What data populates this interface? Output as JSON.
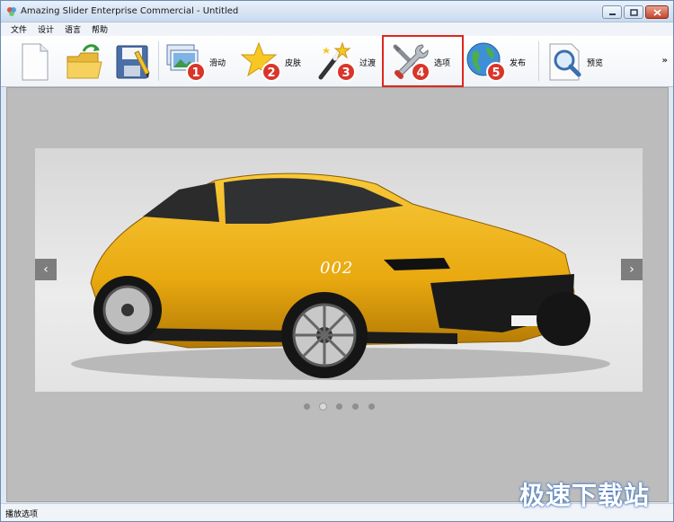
{
  "window": {
    "title": "Amazing Slider Enterprise Commercial - Untitled"
  },
  "menu": {
    "items": [
      "文件",
      "设计",
      "语言",
      "帮助"
    ]
  },
  "toolbar": {
    "buttons": [
      {
        "icon": "new-file-icon",
        "label": ""
      },
      {
        "icon": "open-folder-icon",
        "label": ""
      },
      {
        "icon": "save-disk-icon",
        "label": ""
      },
      {
        "icon": "slides-icon",
        "label": "滑动",
        "step": "1"
      },
      {
        "icon": "star-skin-icon",
        "label": "皮肤",
        "step": "2"
      },
      {
        "icon": "magic-wand-icon",
        "label": "过渡",
        "step": "3"
      },
      {
        "icon": "tools-icon",
        "label": "选项",
        "step": "4"
      },
      {
        "icon": "globe-publish-icon",
        "label": "发布",
        "step": "5"
      },
      {
        "icon": "magnifier-preview-icon",
        "label": "预览"
      }
    ],
    "overflow": "»",
    "highlighted": "选项"
  },
  "slider": {
    "caption": "002",
    "prev_arrow": "‹",
    "next_arrow": "›",
    "dot_count": 5,
    "active_dot": 2
  },
  "status": {
    "text": "播放选项"
  },
  "watermark": {
    "text": "极速下载站"
  }
}
